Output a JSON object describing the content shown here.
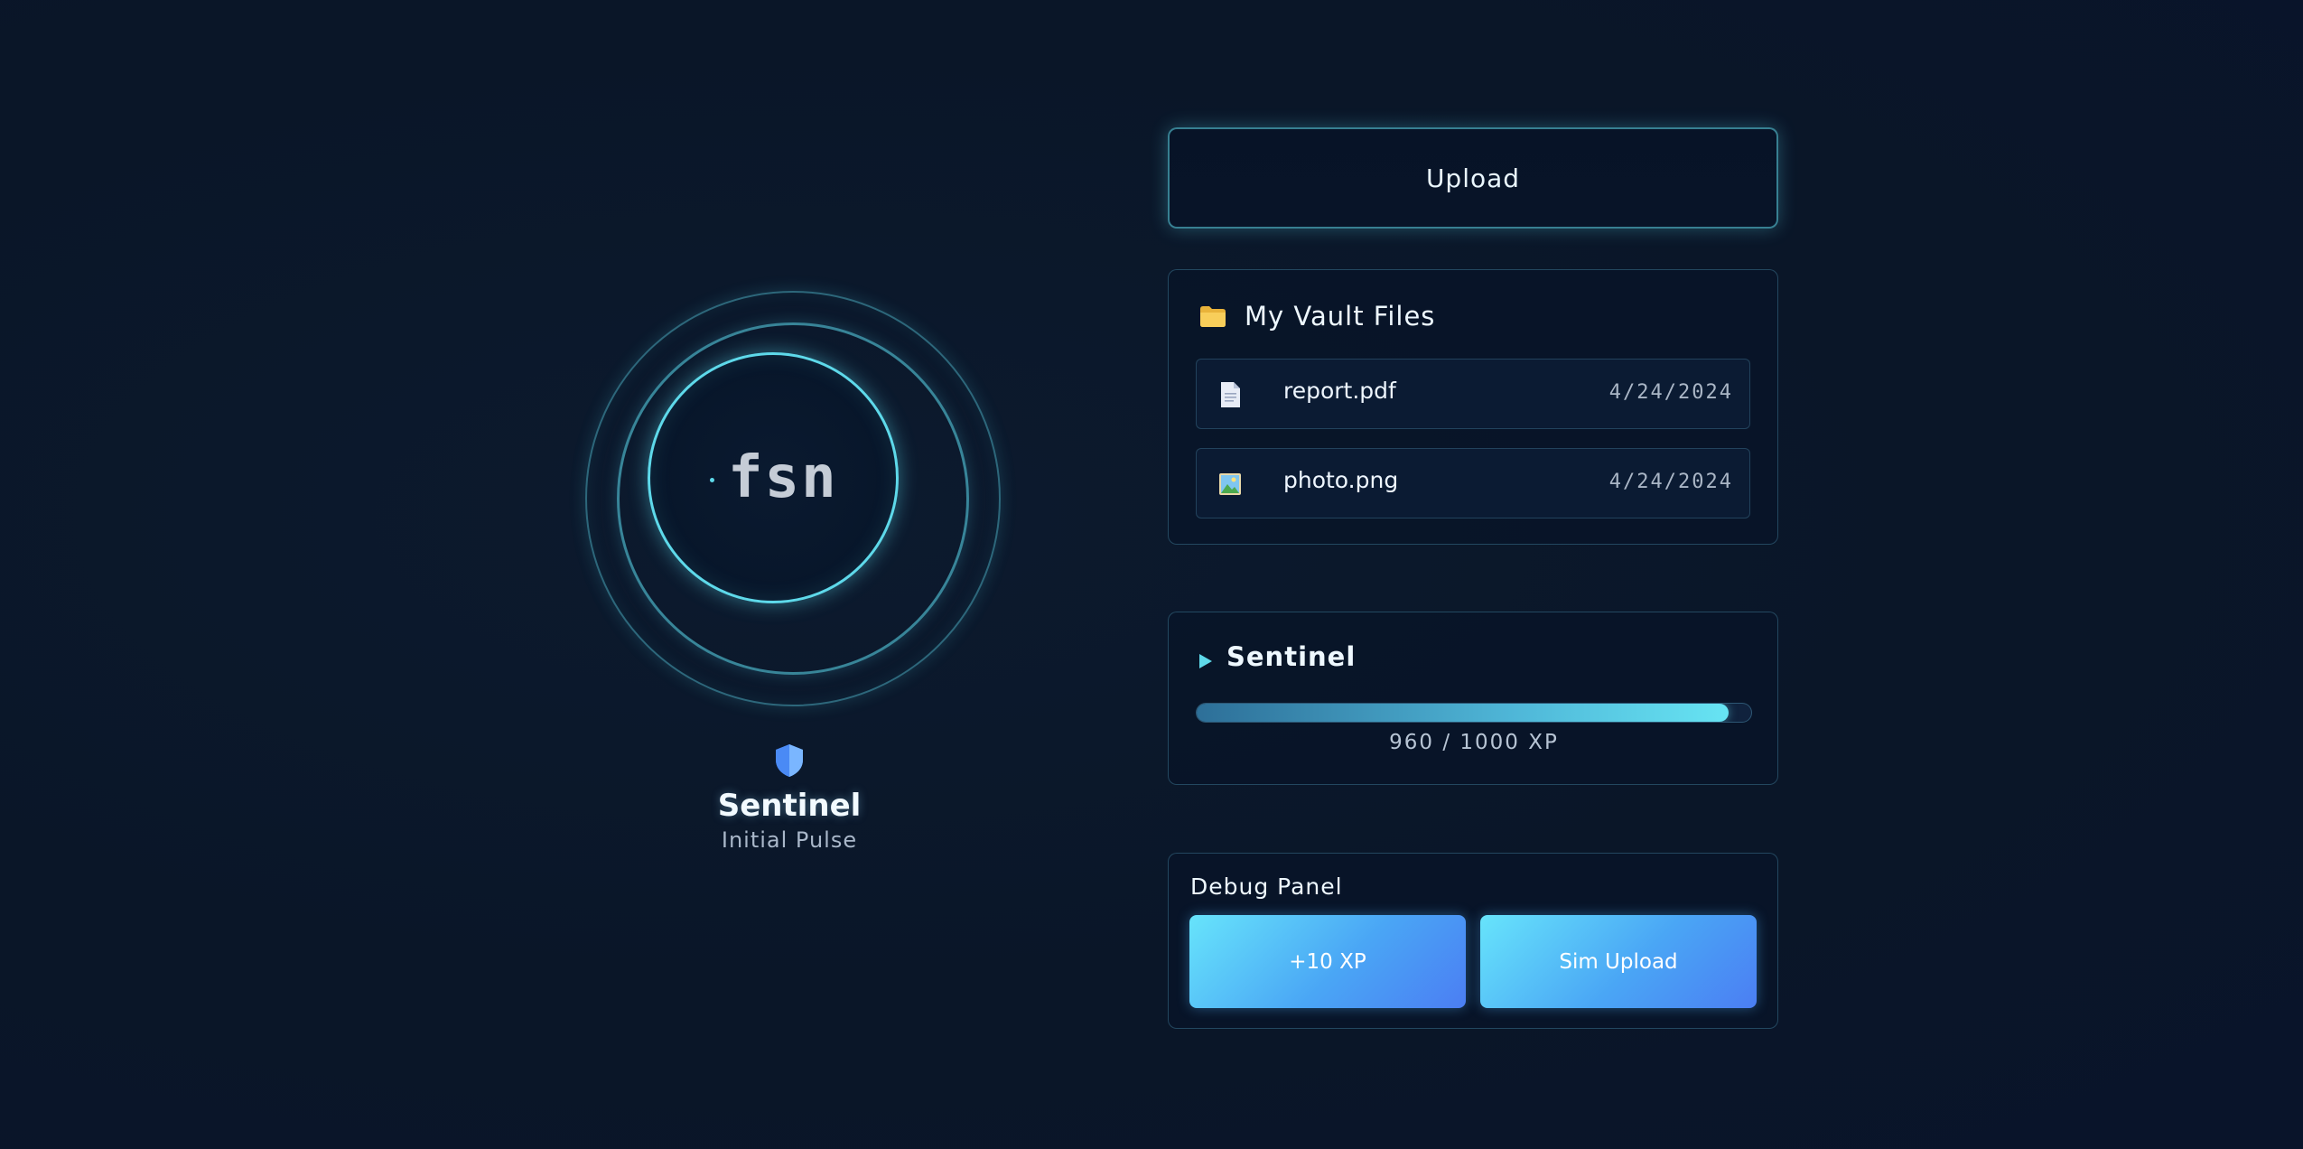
{
  "orb": {
    "label": "fsn"
  },
  "rank": {
    "icon": "shield-icon",
    "title": "Sentinel",
    "subtitle": "Initial Pulse"
  },
  "upload": {
    "label": "Upload"
  },
  "vault": {
    "icon": "folder-icon",
    "title": "My Vault Files",
    "files": [
      {
        "icon": "document-icon",
        "name": "report.pdf",
        "date": "4/24/2024"
      },
      {
        "icon": "image-icon",
        "name": "photo.png",
        "date": "4/24/2024"
      }
    ]
  },
  "progress": {
    "icon": "play-icon",
    "title": "Sentinel",
    "xp_current": 960,
    "xp_max": 1000,
    "xp_text": "960 / 1000 XP"
  },
  "debug": {
    "title": "Debug Panel",
    "buttons": [
      {
        "label": "+10 XP"
      },
      {
        "label": "Sim Upload"
      }
    ]
  },
  "colors": {
    "background": "#0a1628",
    "accent": "#5ed9ea",
    "button_gradient_start": "#67e4fb",
    "button_gradient_end": "#4b7ef3"
  }
}
